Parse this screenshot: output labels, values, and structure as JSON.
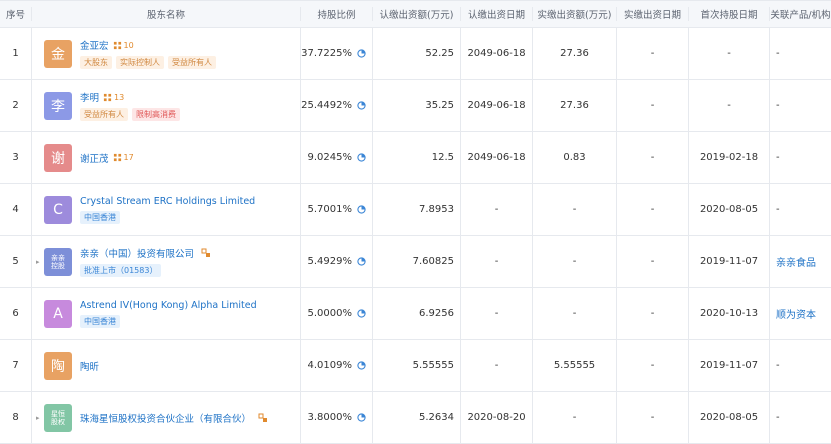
{
  "headers": [
    "序号",
    "股东名称",
    "持股比例",
    "认缴出资额(万元)",
    "认缴出资日期",
    "实缴出资额(万元)",
    "实缴出资日期",
    "首次持股日期",
    "关联产品/机构"
  ],
  "rows": [
    {
      "no": "1",
      "logo": "金",
      "logo_color": "#e8a263",
      "name": "金亚宏",
      "badge": "10",
      "tags": [
        {
          "text": "大股东",
          "tone": "orange"
        },
        {
          "text": "实际控制人",
          "tone": "orange"
        },
        {
          "text": "受益所有人",
          "tone": "orange"
        }
      ],
      "ratio": "37.7225%",
      "sub_amt": "52.25",
      "sub_date": "2049-06-18",
      "paid_amt": "27.36",
      "paid_date": "-",
      "first_date": "-",
      "related": "-"
    },
    {
      "no": "2",
      "logo": "李",
      "logo_color": "#8c99e6",
      "name": "李明",
      "badge": "13",
      "tags": [
        {
          "text": "受益所有人",
          "tone": "orange"
        },
        {
          "text": "限制高消费",
          "tone": "red"
        }
      ],
      "ratio": "25.4492%",
      "sub_amt": "35.25",
      "sub_date": "2049-06-18",
      "paid_amt": "27.36",
      "paid_date": "-",
      "first_date": "-",
      "related": "-"
    },
    {
      "no": "3",
      "logo": "谢",
      "logo_color": "#e58b8b",
      "name": "谢正茂",
      "badge": "17",
      "tags": [],
      "ratio": "9.0245%",
      "sub_amt": "12.5",
      "sub_date": "2049-06-18",
      "paid_amt": "0.83",
      "paid_date": "-",
      "first_date": "2019-02-18",
      "related": "-"
    },
    {
      "no": "4",
      "logo": "C",
      "logo_color": "#9d8bdc",
      "name": "Crystal Stream ERC Holdings Limited",
      "tags": [
        {
          "text": "中国香港",
          "tone": "blue"
        }
      ],
      "ratio": "5.7001%",
      "sub_amt": "7.8953",
      "sub_date": "-",
      "paid_amt": "-",
      "paid_date": "-",
      "first_date": "2020-08-05",
      "related": "-"
    },
    {
      "no": "5",
      "logo": "亲亲\n控股",
      "logo_color": "#7d8fd8",
      "small": true,
      "expander": "▸",
      "name": "亲亲（中国）投资有限公司",
      "relicon": true,
      "tags": [
        {
          "text": "批准上市（01583）",
          "tone": "blue"
        }
      ],
      "ratio": "5.4929%",
      "sub_amt": "7.60825",
      "sub_date": "-",
      "paid_amt": "-",
      "paid_date": "-",
      "first_date": "2019-11-07",
      "related": "亲亲食品",
      "related_link": true
    },
    {
      "no": "6",
      "logo": "A",
      "logo_color": "#c78add",
      "name": "Astrend IV(Hong Kong) Alpha Limited",
      "tags": [
        {
          "text": "中国香港",
          "tone": "blue"
        }
      ],
      "ratio": "5.0000%",
      "sub_amt": "6.9256",
      "sub_date": "-",
      "paid_amt": "-",
      "paid_date": "-",
      "first_date": "2020-10-13",
      "related": "顺为资本",
      "related_link": true
    },
    {
      "no": "7",
      "logo": "陶",
      "logo_color": "#e8a263",
      "name": "陶昕",
      "tags": [],
      "ratio": "4.0109%",
      "sub_amt": "5.55555",
      "sub_date": "-",
      "paid_amt": "5.55555",
      "paid_date": "-",
      "first_date": "2019-11-07",
      "related": "-"
    },
    {
      "no": "8",
      "logo": "星恒\n股权",
      "logo_color": "#82c6a5",
      "small": true,
      "expander": "▸",
      "name": "珠海星恒股权投资合伙企业（有限合伙）",
      "relicon": true,
      "tags": [],
      "ratio": "3.8000%",
      "sub_amt": "5.2634",
      "sub_date": "2020-08-20",
      "paid_amt": "-",
      "paid_date": "-",
      "first_date": "2020-08-05",
      "related": "-"
    }
  ]
}
